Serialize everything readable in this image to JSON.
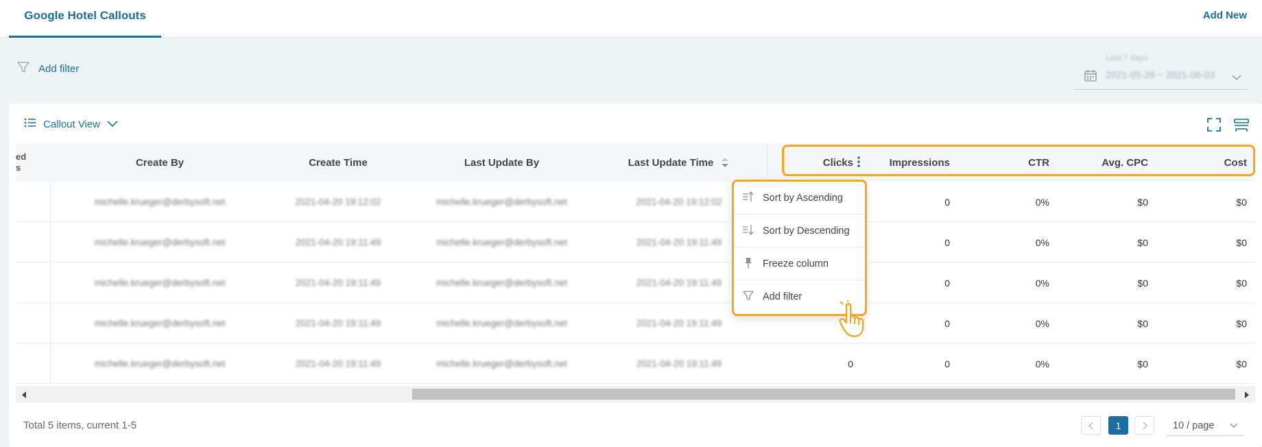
{
  "header": {
    "active_tab": "Google Hotel Callouts",
    "add_new": "Add New"
  },
  "filter": {
    "add_filter": "Add filter",
    "date_caption": "Last 7 days",
    "date_range": "2021-05-28 ~ 2021-06-03"
  },
  "view": {
    "label": "Callout View"
  },
  "table": {
    "partial_col": "ed\ns",
    "columns": [
      "Create By",
      "Create Time",
      "Last Update By",
      "Last Update Time",
      "Clicks",
      "Impressions",
      "CTR",
      "Avg. CPC",
      "Cost"
    ],
    "rows": [
      {
        "create_by": "michelle.krueger@derbysoft.net",
        "create_time": "2021-04-20 19:12:02",
        "update_by": "michelle.krueger@derbysoft.net",
        "update_time": "2021-04-20 19:12:02",
        "clicks": "",
        "impressions": "0",
        "ctr": "0%",
        "cpc": "$0",
        "cost": "$0"
      },
      {
        "create_by": "michelle.krueger@derbysoft.net",
        "create_time": "2021-04-20 19:11:49",
        "update_by": "michelle.krueger@derbysoft.net",
        "update_time": "2021-04-20 19:11:49",
        "clicks": "",
        "impressions": "0",
        "ctr": "0%",
        "cpc": "$0",
        "cost": "$0"
      },
      {
        "create_by": "michelle.krueger@derbysoft.net",
        "create_time": "2021-04-20 19:11:49",
        "update_by": "michelle.krueger@derbysoft.net",
        "update_time": "2021-04-20 19:11:49",
        "clicks": "",
        "impressions": "0",
        "ctr": "0%",
        "cpc": "$0",
        "cost": "$0"
      },
      {
        "create_by": "michelle.krueger@derbysoft.net",
        "create_time": "2021-04-20 19:11:49",
        "update_by": "michelle.krueger@derbysoft.net",
        "update_time": "2021-04-20 19:11:49",
        "clicks": "",
        "impressions": "0",
        "ctr": "0%",
        "cpc": "$0",
        "cost": "$0"
      },
      {
        "create_by": "michelle.krueger@derbysoft.net",
        "create_time": "2021-04-20 19:11:49",
        "update_by": "michelle.krueger@derbysoft.net",
        "update_time": "2021-04-20 19:11:49",
        "clicks": "0",
        "impressions": "0",
        "ctr": "0%",
        "cpc": "$0",
        "cost": "$0"
      }
    ]
  },
  "column_menu": {
    "items": [
      "Sort by Ascending",
      "Sort by Descending",
      "Freeze column",
      "Add filter"
    ]
  },
  "footer": {
    "total": "Total 5 items, current 1-5",
    "current_page": "1",
    "page_size": "10 / page"
  },
  "colors": {
    "accent": "#1a6fa0",
    "highlight": "#f5a623"
  }
}
